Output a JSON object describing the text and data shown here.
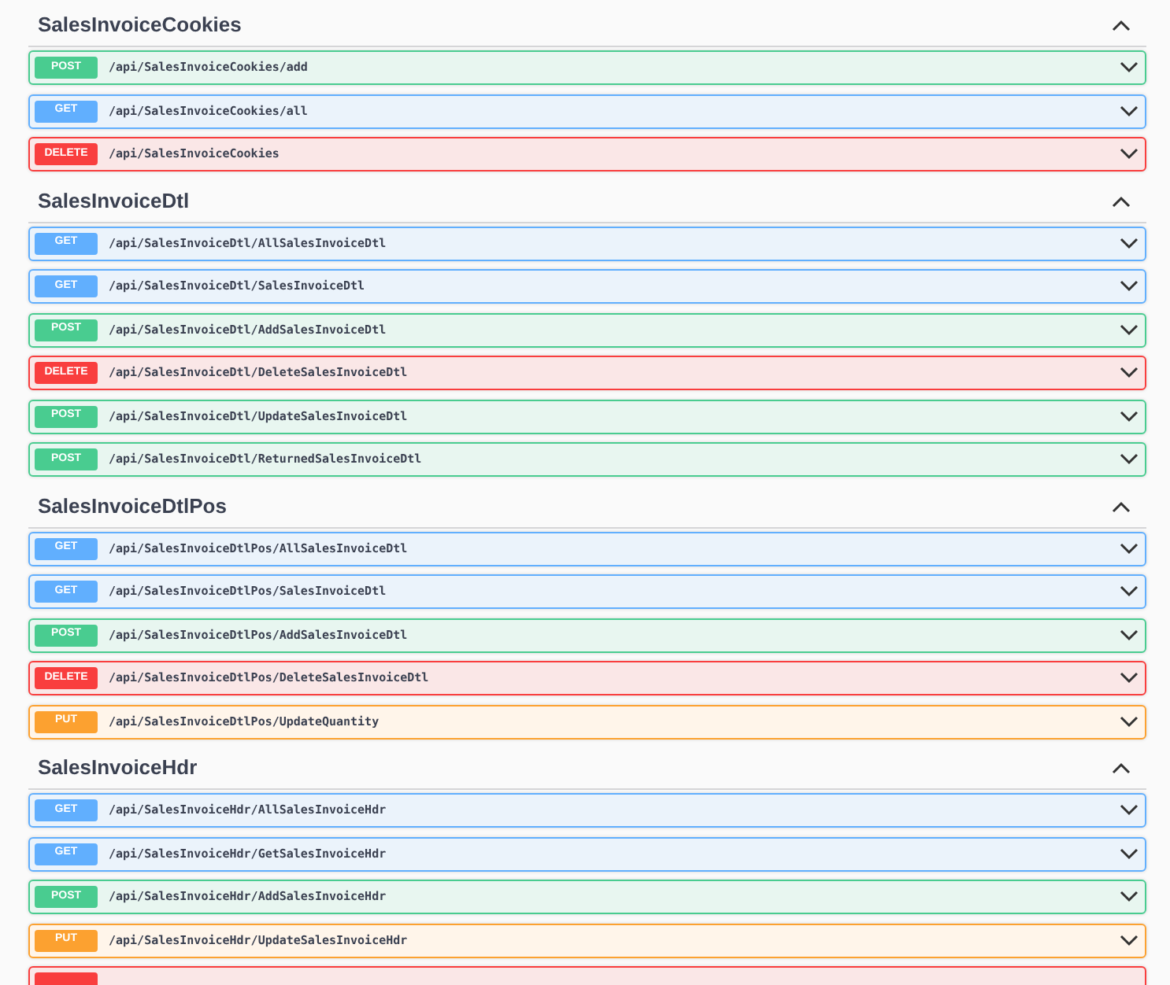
{
  "sections": [
    {
      "title": "SalesInvoiceCookies",
      "expanded": true,
      "operations": [
        {
          "kind": "post",
          "method": "POST",
          "path": "/api/SalesInvoiceCookies/add"
        },
        {
          "kind": "get",
          "method": "GET",
          "path": "/api/SalesInvoiceCookies/all"
        },
        {
          "kind": "delete",
          "method": "DELETE",
          "path": "/api/SalesInvoiceCookies"
        }
      ]
    },
    {
      "title": "SalesInvoiceDtl",
      "expanded": true,
      "operations": [
        {
          "kind": "get",
          "method": "GET",
          "path": "/api/SalesInvoiceDtl/AllSalesInvoiceDtl"
        },
        {
          "kind": "get",
          "method": "GET",
          "path": "/api/SalesInvoiceDtl/SalesInvoiceDtl"
        },
        {
          "kind": "post",
          "method": "POST",
          "path": "/api/SalesInvoiceDtl/AddSalesInvoiceDtl"
        },
        {
          "kind": "delete",
          "method": "DELETE",
          "path": "/api/SalesInvoiceDtl/DeleteSalesInvoiceDtl"
        },
        {
          "kind": "post",
          "method": "POST",
          "path": "/api/SalesInvoiceDtl/UpdateSalesInvoiceDtl"
        },
        {
          "kind": "post",
          "method": "POST",
          "path": "/api/SalesInvoiceDtl/ReturnedSalesInvoiceDtl"
        }
      ]
    },
    {
      "title": "SalesInvoiceDtlPos",
      "expanded": true,
      "operations": [
        {
          "kind": "get",
          "method": "GET",
          "path": "/api/SalesInvoiceDtlPos/AllSalesInvoiceDtl"
        },
        {
          "kind": "get",
          "method": "GET",
          "path": "/api/SalesInvoiceDtlPos/SalesInvoiceDtl"
        },
        {
          "kind": "post",
          "method": "POST",
          "path": "/api/SalesInvoiceDtlPos/AddSalesInvoiceDtl"
        },
        {
          "kind": "delete",
          "method": "DELETE",
          "path": "/api/SalesInvoiceDtlPos/DeleteSalesInvoiceDtl"
        },
        {
          "kind": "put",
          "method": "PUT",
          "path": "/api/SalesInvoiceDtlPos/UpdateQuantity"
        }
      ]
    },
    {
      "title": "SalesInvoiceHdr",
      "expanded": true,
      "operations": [
        {
          "kind": "get",
          "method": "GET",
          "path": "/api/SalesInvoiceHdr/AllSalesInvoiceHdr"
        },
        {
          "kind": "get",
          "method": "GET",
          "path": "/api/SalesInvoiceHdr/GetSalesInvoiceHdr"
        },
        {
          "kind": "post",
          "method": "POST",
          "path": "/api/SalesInvoiceHdr/AddSalesInvoiceHdr"
        },
        {
          "kind": "put",
          "method": "PUT",
          "path": "/api/SalesInvoiceHdr/UpdateSalesInvoiceHdr"
        },
        {
          "kind": "delete"
        }
      ]
    }
  ]
}
